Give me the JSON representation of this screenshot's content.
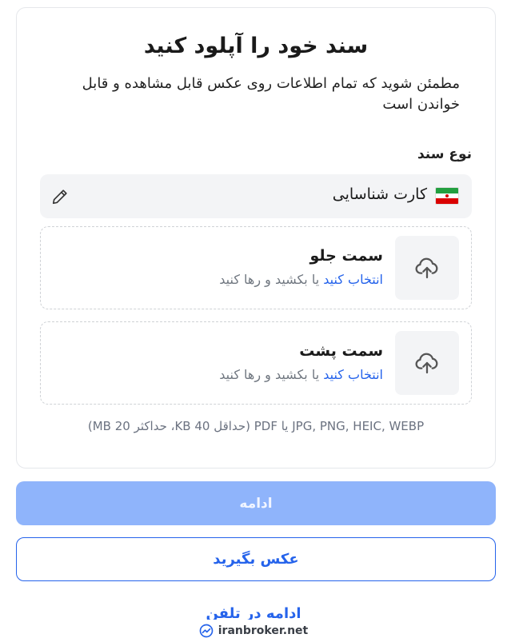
{
  "header": {
    "title": "سند خود را آپلود کنید",
    "subtitle": "مطمئن شوید که تمام اطلاعات روی عکس قابل مشاهده و قابل خواندن است"
  },
  "document_type": {
    "label": "نوع سند",
    "selected_value": "کارت شناسایی",
    "flag_icon": "iran-flag-icon"
  },
  "uploads": {
    "front": {
      "title": "سمت جلو",
      "hint_link": "انتخاب کنید",
      "hint_rest": " یا بکشید و رها کنید"
    },
    "back": {
      "title": "سمت پشت",
      "hint_link": "انتخاب کنید",
      "hint_rest": " یا بکشید و رها کنید"
    }
  },
  "formats_note": "JPG, PNG, HEIC, WEBP یا PDF (حداقل 40 KB، حداکثر 20 MB)",
  "actions": {
    "continue_label": "ادامه",
    "take_photo_label": "عکس بگیرید",
    "continue_on_phone_label": "ادامه در تلفن"
  },
  "watermark": {
    "text": "iranbroker.net"
  },
  "colors": {
    "accent": "#2563eb",
    "disabled_button": "#8fb4fb",
    "surface": "#f3f4f6"
  }
}
